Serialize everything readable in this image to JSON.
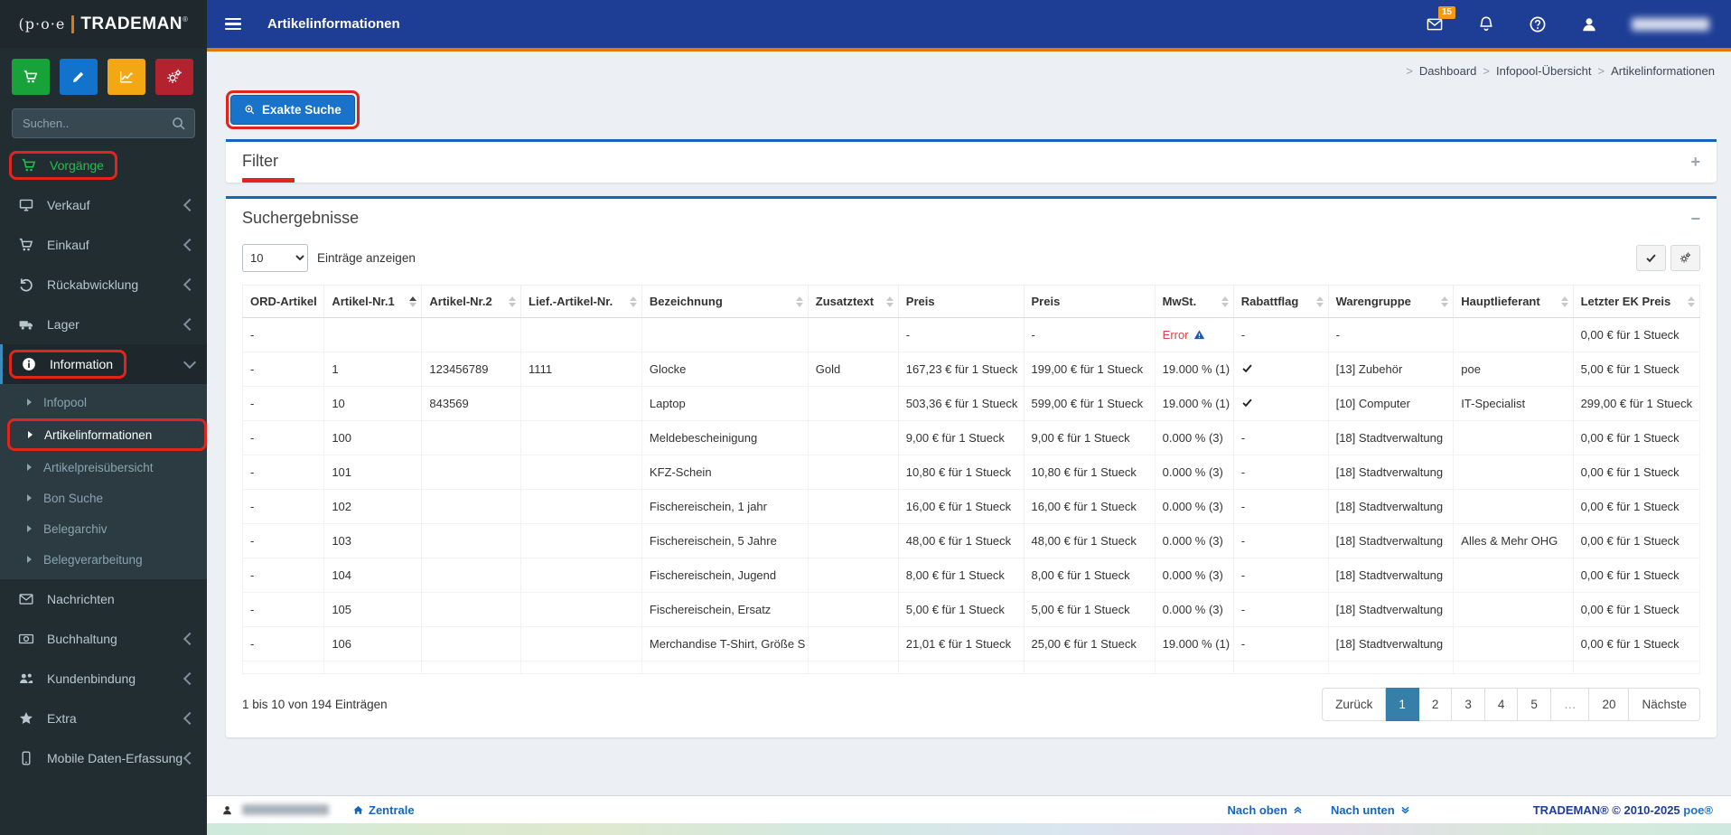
{
  "brand": {
    "logo_poe": "(p·o·e",
    "logo_name": "TRADEMAN",
    "reg": "®"
  },
  "topbar": {
    "title": "Artikelinformationen",
    "mail_badge": "15"
  },
  "breadcrumb": {
    "items": [
      "Dashboard",
      "Infopool-Übersicht",
      "Artikelinformationen"
    ]
  },
  "sidebar": {
    "search_placeholder": "Suchen..",
    "items": [
      {
        "label": "Vorgänge",
        "icon": "cart",
        "style": "vorgaenge",
        "annotated": true
      },
      {
        "label": "Verkauf",
        "icon": "monitor",
        "chevron": "left"
      },
      {
        "label": "Einkauf",
        "icon": "cart",
        "chevron": "left"
      },
      {
        "label": "Rückabwicklung",
        "icon": "undo",
        "chevron": "left"
      },
      {
        "label": "Lager",
        "icon": "truck",
        "chevron": "left"
      },
      {
        "label": "Information",
        "icon": "info",
        "chevron": "down",
        "active": true,
        "annotated": true,
        "submenu": [
          {
            "label": "Infopool"
          },
          {
            "label": "Artikelinformationen",
            "active": true,
            "annotated": true
          },
          {
            "label": "Artikelpreisübersicht"
          },
          {
            "label": "Bon Suche"
          },
          {
            "label": "Belegarchiv"
          },
          {
            "label": "Belegverarbeitung"
          }
        ]
      },
      {
        "label": "Nachrichten",
        "icon": "envelope"
      },
      {
        "label": "Buchhaltung",
        "icon": "money",
        "chevron": "left"
      },
      {
        "label": "Kundenbindung",
        "icon": "users",
        "chevron": "left"
      },
      {
        "label": "Extra",
        "icon": "star",
        "chevron": "left"
      },
      {
        "label": "Mobile Daten-Erfassung",
        "icon": "mobile",
        "chevron": "left"
      }
    ]
  },
  "actions": {
    "exact_search": "Exakte Suche"
  },
  "filter_panel": {
    "title": "Filter",
    "collapse": "+"
  },
  "results_panel": {
    "title": "Suchergebnisse",
    "collapse": "−",
    "page_size": "10",
    "page_size_label": "Einträge anzeigen",
    "columns": [
      {
        "label": "ORD-Artikel",
        "sortable": false
      },
      {
        "label": "Artikel-Nr.1",
        "sortable": true,
        "sorted": "asc"
      },
      {
        "label": "Artikel-Nr.2",
        "sortable": true
      },
      {
        "label": "Lief.-Artikel-Nr.",
        "sortable": true
      },
      {
        "label": "Bezeichnung",
        "sortable": true
      },
      {
        "label": "Zusatztext",
        "sortable": true
      },
      {
        "label": "Preis",
        "sortable": false
      },
      {
        "label": "Preis",
        "sortable": false
      },
      {
        "label": "MwSt.",
        "sortable": true
      },
      {
        "label": "Rabattflag",
        "sortable": true
      },
      {
        "label": "Warengruppe",
        "sortable": true
      },
      {
        "label": "Hauptlieferant",
        "sortable": true
      },
      {
        "label": "Letzter EK Preis",
        "sortable": true
      }
    ],
    "rows": [
      [
        "-",
        "",
        "",
        "",
        "",
        "",
        "-",
        "-",
        "Error",
        "-",
        "-",
        "",
        "0,00 € für 1 Stueck"
      ],
      [
        "-",
        "1",
        "123456789",
        "1111",
        "Glocke",
        "Gold",
        "167,23 € für 1 Stueck",
        "199,00 € für 1 Stueck",
        "19.000 % (1)",
        "✔",
        "[13] Zubehör",
        "poe",
        "5,00 € für 1 Stueck"
      ],
      [
        "-",
        "10",
        "843569",
        "",
        "Laptop",
        "",
        "503,36 € für 1 Stueck",
        "599,00 € für 1 Stueck",
        "19.000 % (1)",
        "✔",
        "[10] Computer",
        "IT-Specialist",
        "299,00 € für 1 Stueck"
      ],
      [
        "-",
        "100",
        "",
        "",
        "Meldebescheinigung",
        "",
        "9,00 € für 1 Stueck",
        "9,00 € für 1 Stueck",
        "0.000 % (3)",
        "-",
        "[18] Stadtverwaltung",
        "",
        "0,00 € für 1 Stueck"
      ],
      [
        "-",
        "101",
        "",
        "",
        "KFZ-Schein",
        "",
        "10,80 € für 1 Stueck",
        "10,80 € für 1 Stueck",
        "0.000 % (3)",
        "-",
        "[18] Stadtverwaltung",
        "",
        "0,00 € für 1 Stueck"
      ],
      [
        "-",
        "102",
        "",
        "",
        "Fischereischein, 1 jahr",
        "",
        "16,00 € für 1 Stueck",
        "16,00 € für 1 Stueck",
        "0.000 % (3)",
        "-",
        "[18] Stadtverwaltung",
        "",
        "0,00 € für 1 Stueck"
      ],
      [
        "-",
        "103",
        "",
        "",
        "Fischereischein, 5 Jahre",
        "",
        "48,00 € für 1 Stueck",
        "48,00 € für 1 Stueck",
        "0.000 % (3)",
        "-",
        "[18] Stadtverwaltung",
        "Alles & Mehr OHG",
        "0,00 € für 1 Stueck"
      ],
      [
        "-",
        "104",
        "",
        "",
        "Fischereischein, Jugend",
        "",
        "8,00 € für 1 Stueck",
        "8,00 € für 1 Stueck",
        "0.000 % (3)",
        "-",
        "[18] Stadtverwaltung",
        "",
        "0,00 € für 1 Stueck"
      ],
      [
        "-",
        "105",
        "",
        "",
        "Fischereischein, Ersatz",
        "",
        "5,00 € für 1 Stueck",
        "5,00 € für 1 Stueck",
        "0.000 % (3)",
        "-",
        "[18] Stadtverwaltung",
        "",
        "0,00 € für 1 Stueck"
      ],
      [
        "-",
        "106",
        "",
        "",
        "Merchandise T-Shirt, Größe S",
        "",
        "21,01 € für 1 Stueck",
        "25,00 € für 1 Stueck",
        "19.000 % (1)",
        "-",
        "[18] Stadtverwaltung",
        "",
        "0,00 € für 1 Stueck"
      ]
    ],
    "info": "1 bis 10 von 194 Einträgen",
    "pagination": [
      {
        "label": "Zurück"
      },
      {
        "label": "1",
        "active": true
      },
      {
        "label": "2"
      },
      {
        "label": "3"
      },
      {
        "label": "4"
      },
      {
        "label": "5"
      },
      {
        "label": "…",
        "ellipsis": true
      },
      {
        "label": "20"
      },
      {
        "label": "Nächste"
      }
    ]
  },
  "footer": {
    "zentrale": "Zentrale",
    "nach_oben": "Nach oben",
    "nach_unten": "Nach unten",
    "copyright": "TRADEMAN® © 2010-2025",
    "copyright_poe": "poe®"
  },
  "colors": {
    "topbar_blue": "#1e3e96",
    "accent_orange": "#e2790b",
    "annotation_red": "#e0261c",
    "link_blue": "#1266c0",
    "error_red": "#d64541",
    "badge_orange": "#f39c12",
    "active_page_blue": "#367fa9",
    "sidebar_green": "#1fc04e"
  }
}
